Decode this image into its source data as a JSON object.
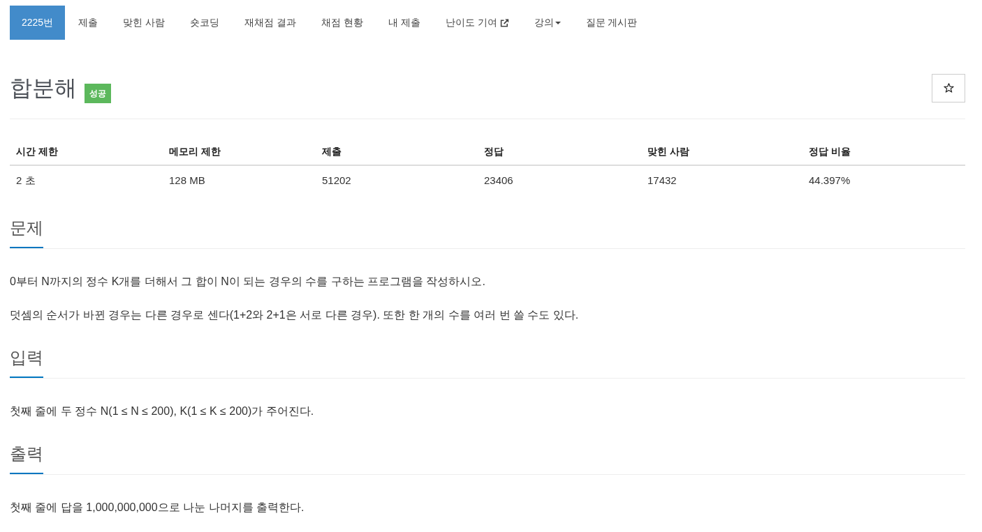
{
  "nav": {
    "tabs": [
      {
        "label": "2225번",
        "kind": "link",
        "selected": true
      },
      {
        "label": "제출",
        "kind": "link",
        "selected": false
      },
      {
        "label": "맞힌 사람",
        "kind": "link",
        "selected": false
      },
      {
        "label": "숏코딩",
        "kind": "link",
        "selected": false
      },
      {
        "label": "재채점 결과",
        "kind": "link",
        "selected": false
      },
      {
        "label": "채점 현황",
        "kind": "link",
        "selected": false
      },
      {
        "label": "내 제출",
        "kind": "link",
        "selected": false
      },
      {
        "label": "난이도 기여",
        "kind": "external",
        "selected": false
      },
      {
        "label": "강의",
        "kind": "dropdown",
        "selected": false
      },
      {
        "label": "질문 게시판",
        "kind": "link",
        "selected": false
      }
    ]
  },
  "problem": {
    "title": "합분해",
    "result": "성공",
    "starred": false
  },
  "info_table": {
    "columns": [
      "시간 제한",
      "메모리 제한",
      "제출",
      "정답",
      "맞힌 사람",
      "정답 비율"
    ],
    "rows": [
      [
        "2 초",
        "128 MB",
        "51202",
        "23406",
        "17432",
        "44.397%"
      ]
    ]
  },
  "sections": [
    {
      "heading": "문제",
      "paragraphs": [
        "0부터 N까지의 정수 K개를 더해서 그 합이 N이 되는 경우의 수를 구하는 프로그램을 작성하시오.",
        "덧셈의 순서가 바뀐 경우는 다른 경우로 센다(1+2와 2+1은 서로 다른 경우). 또한 한 개의 수를 여러 번 쓸 수도 있다."
      ]
    },
    {
      "heading": "입력",
      "paragraphs": [
        "첫째 줄에 두 정수 N(1 ≤ N ≤ 200), K(1 ≤ K ≤ 200)가 주어진다."
      ]
    },
    {
      "heading": "출력",
      "paragraphs": [
        "첫째 줄에 답을 1,000,000,000으로 나눈 나머지를 출력한다."
      ]
    }
  ]
}
